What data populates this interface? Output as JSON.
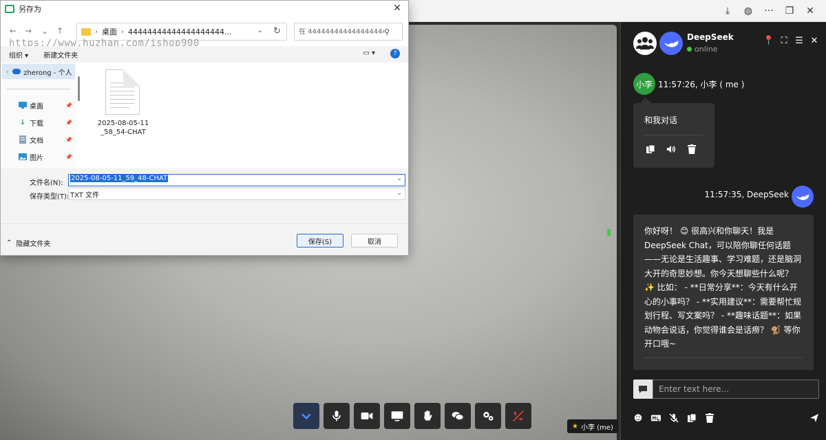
{
  "browser": {
    "controls": {
      "download": "⤓",
      "globe": "◍",
      "more": "···",
      "restore": "❐",
      "close": "✕"
    }
  },
  "dialog": {
    "title": "另存为",
    "watermark": "https://www.huzhan.com/ishop900",
    "address": {
      "crumb1": "桌面",
      "crumb2": "44444444444444444444..."
    },
    "search": {
      "placeholder": "在 444444444444444444..."
    },
    "toolbar": {
      "organize": "组织 ▾",
      "new_folder": "新建文件夹"
    },
    "nav": {
      "onedrive": "zherong - 个人",
      "items": [
        {
          "label": "桌面"
        },
        {
          "label": "下载"
        },
        {
          "label": "文档"
        },
        {
          "label": "图片"
        }
      ]
    },
    "file": {
      "name": "2025-08-05-11_58_54-CHAT"
    },
    "form": {
      "filename_label": "文件名(N):",
      "filename_value": "2025-08-05-11_59_48-CHAT",
      "filetype_label": "保存类型(T):",
      "filetype_value": "TXT 文件"
    },
    "footer": {
      "hide_folders": "隐藏文件夹",
      "save": "保存(S)",
      "cancel": "取消"
    }
  },
  "chat": {
    "title": "DeepSeek",
    "status": "online",
    "messages": [
      {
        "avatar": "小李",
        "meta": "11:57:26, 小李 ( me )",
        "text": "和我对话"
      },
      {
        "meta": "11:57:35, DeepSeek",
        "text": "你好呀！ 😊 很高兴和你聊天！我是DeepSeek Chat，可以陪你聊任何话题——无论是生活趣事、学习难题，还是脑洞大开的奇思妙想。你今天想聊些什么呢？ ✨ 比如： - **日常分享**：今天有什么开心的小事吗？ - **实用建议**：需要帮忙规划行程、写文案吗？ - **趣味话题**：如果动物会说话，你觉得谁会是话痨？ 🐒 等你开口哦~"
      }
    ],
    "input_placeholder": "Enter text here..."
  },
  "video": {
    "name_tag": "小李 (me)"
  },
  "colors": {
    "accent": "#1f6fd1",
    "deepseek": "#4d6bfe",
    "online": "#3ccf3c",
    "chat_bg": "#1e1e1e",
    "bubble": "#333333"
  }
}
